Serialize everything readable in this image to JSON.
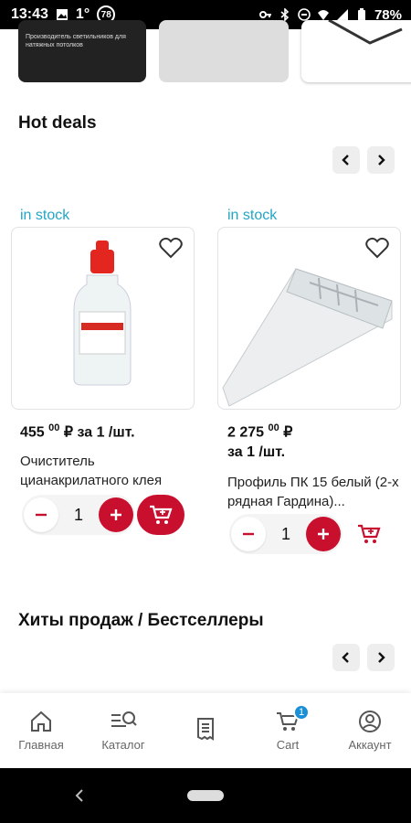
{
  "status": {
    "time": "13:43",
    "temp": "1°",
    "badge": "78",
    "battery": "78%"
  },
  "top_banner": {
    "text": "Производитель светильников для натяжных потолков"
  },
  "hot_deals": {
    "title": "Hot deals",
    "products": [
      {
        "stock": "in stock",
        "price_main": "455",
        "price_cents": "00",
        "price_unit": "₽ за 1 /шт.",
        "name": "Очиститель цианакрилатного клея",
        "qty": "1"
      },
      {
        "stock": "in stock",
        "price_main": "2 275",
        "price_cents": "00",
        "price_currency": "₽",
        "price_unit": "за 1 /шт.",
        "name": "Профиль ПК 15 белый (2-х рядная Гардина)...",
        "qty": "1"
      }
    ]
  },
  "bestsellers": {
    "title": "Хиты продаж / Бестселлеры"
  },
  "nav": {
    "cart_badge": "1",
    "items": [
      {
        "label": "Главная",
        "icon": "home-icon"
      },
      {
        "label": "Каталог",
        "icon": "catalog-search-icon"
      },
      {
        "label": "",
        "icon": "receipt-icon"
      },
      {
        "label": "Cart",
        "icon": "cart-icon"
      },
      {
        "label": "Аккаунт",
        "icon": "account-icon"
      }
    ]
  },
  "colors": {
    "accent": "#c8102e",
    "stock": "#22a6c4",
    "badge": "#1a8fd6"
  }
}
